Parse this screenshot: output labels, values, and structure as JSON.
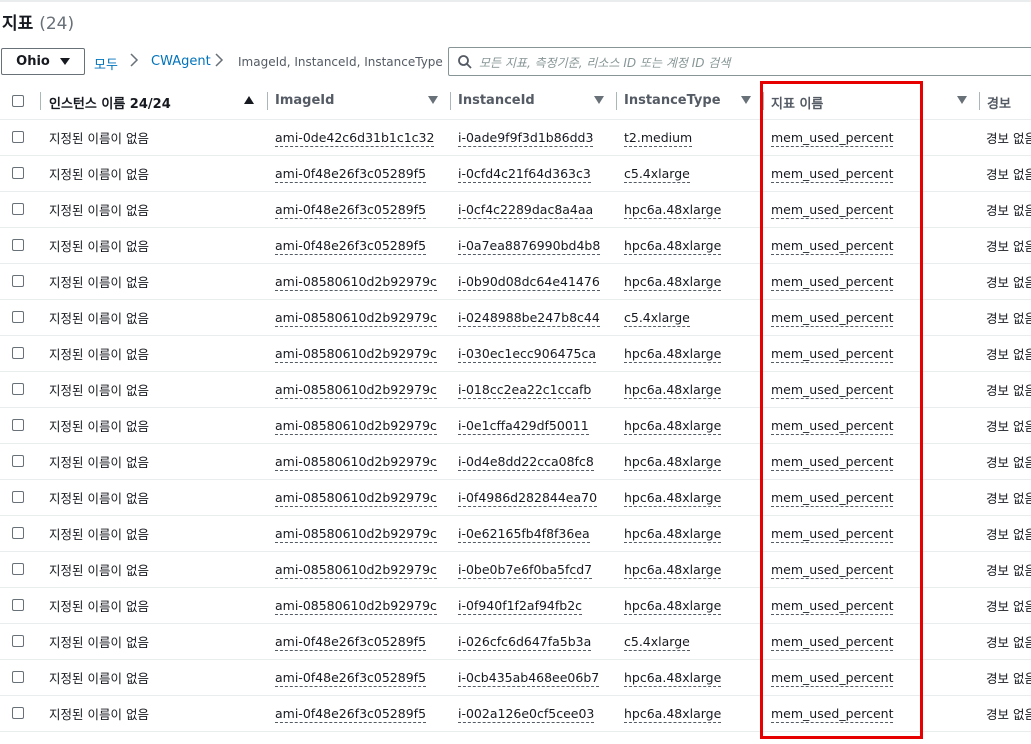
{
  "header": {
    "title": "지표",
    "count": "(24)"
  },
  "region": {
    "label": "Ohio"
  },
  "breadcrumb": {
    "all": "모두",
    "namespace": "CWAgent",
    "dimensions": "ImageId, InstanceId, InstanceType"
  },
  "search": {
    "placeholder": "모든 지표, 측정기준, 리소스 ID 또는 계정 ID 검색",
    "value": ""
  },
  "table": {
    "columns": [
      "인스턴스 이름 24/24",
      "ImageId",
      "InstanceId",
      "InstanceType",
      "지표 이름",
      "경보"
    ],
    "rows": [
      [
        "지정된 이름이 없음",
        "ami-0de42c6d31b1c1c32",
        "i-0ade9f9f3d1b86dd3",
        "t2.medium",
        "mem_used_percent",
        "경보 없음"
      ],
      [
        "지정된 이름이 없음",
        "ami-0f48e26f3c05289f5",
        "i-0cfd4c21f64d363c3",
        "c5.4xlarge",
        "mem_used_percent",
        "경보 없음"
      ],
      [
        "지정된 이름이 없음",
        "ami-0f48e26f3c05289f5",
        "i-0cf4c2289dac8a4aa",
        "hpc6a.48xlarge",
        "mem_used_percent",
        "경보 없음"
      ],
      [
        "지정된 이름이 없음",
        "ami-0f48e26f3c05289f5",
        "i-0a7ea8876990bd4b8",
        "hpc6a.48xlarge",
        "mem_used_percent",
        "경보 없음"
      ],
      [
        "지정된 이름이 없음",
        "ami-08580610d2b92979c",
        "i-0b90d08dc64e41476",
        "hpc6a.48xlarge",
        "mem_used_percent",
        "경보 없음"
      ],
      [
        "지정된 이름이 없음",
        "ami-08580610d2b92979c",
        "i-0248988be247b8c44",
        "c5.4xlarge",
        "mem_used_percent",
        "경보 없음"
      ],
      [
        "지정된 이름이 없음",
        "ami-08580610d2b92979c",
        "i-030ec1ecc906475ca",
        "hpc6a.48xlarge",
        "mem_used_percent",
        "경보 없음"
      ],
      [
        "지정된 이름이 없음",
        "ami-08580610d2b92979c",
        "i-018cc2ea22c1ccafb",
        "hpc6a.48xlarge",
        "mem_used_percent",
        "경보 없음"
      ],
      [
        "지정된 이름이 없음",
        "ami-08580610d2b92979c",
        "i-0e1cffa429df50011",
        "hpc6a.48xlarge",
        "mem_used_percent",
        "경보 없음"
      ],
      [
        "지정된 이름이 없음",
        "ami-08580610d2b92979c",
        "i-0d4e8dd22cca08fc8",
        "hpc6a.48xlarge",
        "mem_used_percent",
        "경보 없음"
      ],
      [
        "지정된 이름이 없음",
        "ami-08580610d2b92979c",
        "i-0f4986d282844ea70",
        "hpc6a.48xlarge",
        "mem_used_percent",
        "경보 없음"
      ],
      [
        "지정된 이름이 없음",
        "ami-08580610d2b92979c",
        "i-0e62165fb4f8f36ea",
        "hpc6a.48xlarge",
        "mem_used_percent",
        "경보 없음"
      ],
      [
        "지정된 이름이 없음",
        "ami-08580610d2b92979c",
        "i-0be0b7e6f0ba5fcd7",
        "hpc6a.48xlarge",
        "mem_used_percent",
        "경보 없음"
      ],
      [
        "지정된 이름이 없음",
        "ami-08580610d2b92979c",
        "i-0f940f1f2af94fb2c",
        "hpc6a.48xlarge",
        "mem_used_percent",
        "경보 없음"
      ],
      [
        "지정된 이름이 없음",
        "ami-0f48e26f3c05289f5",
        "i-026cfc6d647fa5b3a",
        "c5.4xlarge",
        "mem_used_percent",
        "경보 없음"
      ],
      [
        "지정된 이름이 없음",
        "ami-0f48e26f3c05289f5",
        "i-0cb435ab468ee06b7",
        "hpc6a.48xlarge",
        "mem_used_percent",
        "경보 없음"
      ],
      [
        "지정된 이름이 없음",
        "ami-0f48e26f3c05289f5",
        "i-002a126e0cf5cee03",
        "hpc6a.48xlarge",
        "mem_used_percent",
        "경보 없음"
      ]
    ]
  },
  "colors": {
    "link": "#0073bb",
    "highlight": "#e60000",
    "border": "#eaeded",
    "text": "#16191f"
  },
  "icons": {
    "region_caret": "caret-down-icon",
    "breadcrumb_separator": "chevron-right-icon",
    "search": "search-icon",
    "sort_asc": "sort-ascending-icon",
    "sort": "sort-descending-icon"
  }
}
